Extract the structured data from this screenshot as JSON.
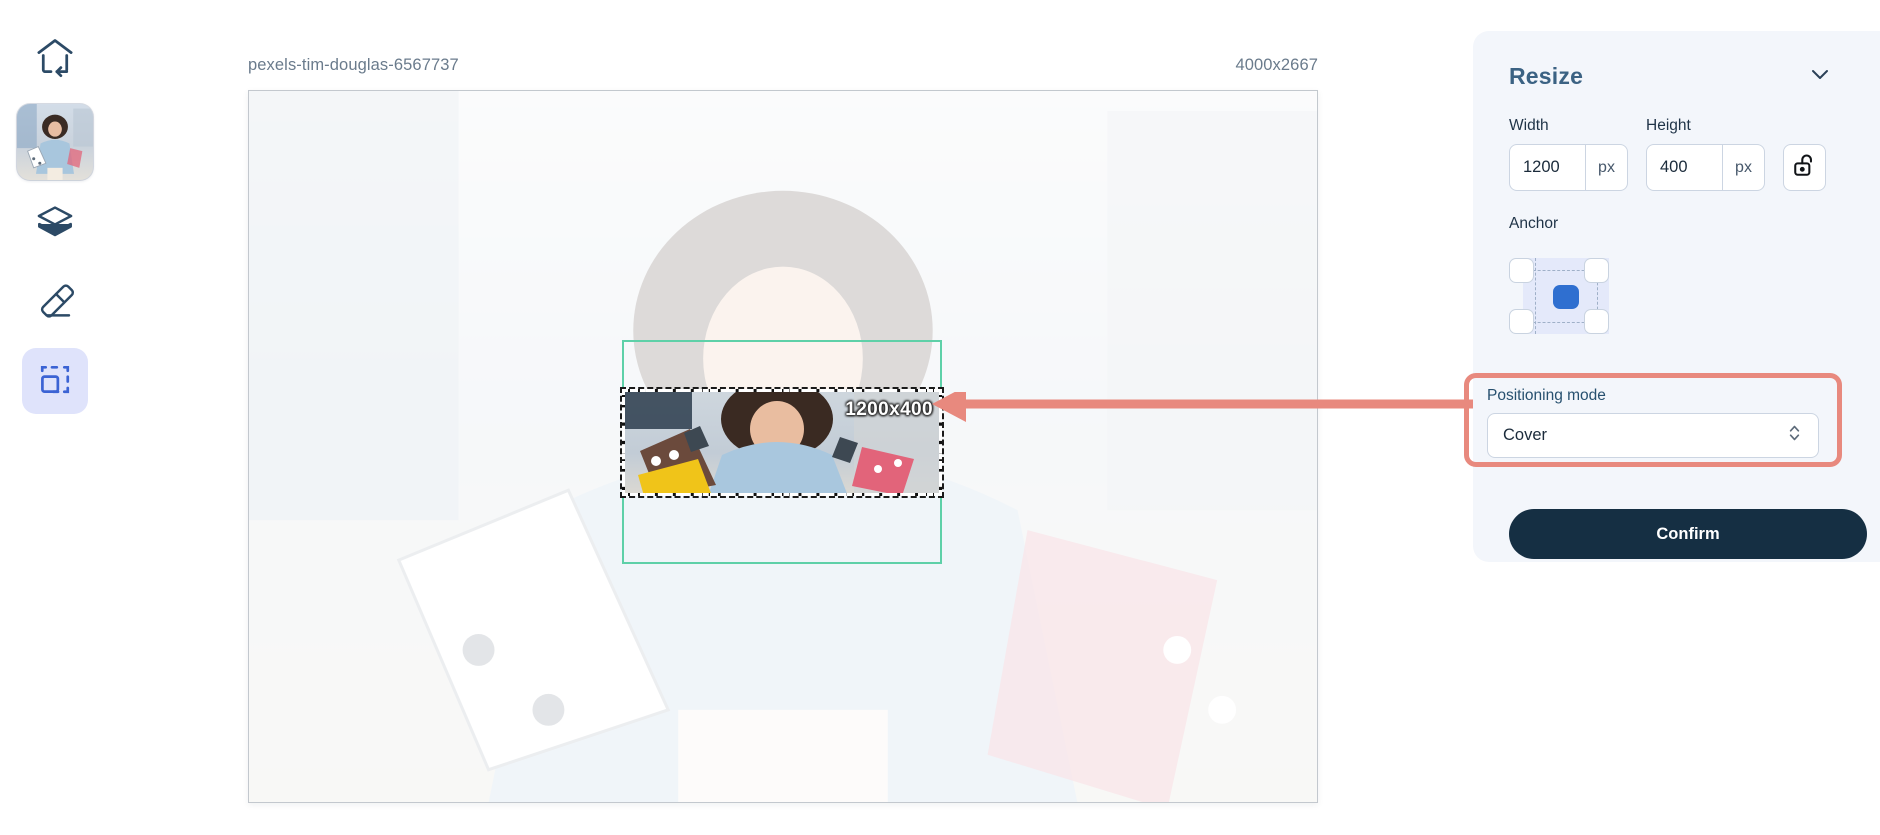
{
  "sidebar": {
    "items": [
      {
        "name": "home-back",
        "icon": "home-arrow-left-icon",
        "label": "Home"
      },
      {
        "name": "image-thumbnail",
        "icon": "image-thumbnail",
        "label": "Image"
      },
      {
        "name": "layers",
        "icon": "layers-icon",
        "label": "Layers"
      },
      {
        "name": "eraser",
        "icon": "eraser-icon",
        "label": "Eraser"
      },
      {
        "name": "resize",
        "icon": "resize-crop-icon",
        "label": "Resize",
        "active": true
      }
    ]
  },
  "canvas": {
    "filename": "pexels-tim-douglas-6567737",
    "dimensions": "4000x2667",
    "preview_dimensions": "1200x400",
    "selection_color": "#5ed0a8",
    "annotation_color": "#e8897e"
  },
  "panel": {
    "title": "Resize",
    "collapse_icon": "chevron-down-icon",
    "width": {
      "label": "Width",
      "value": "1200",
      "unit": "px"
    },
    "height": {
      "label": "Height",
      "value": "400",
      "unit": "px"
    },
    "lock_icon": "unlock-padlock-icon",
    "anchor": {
      "label": "Anchor",
      "selected": "center"
    },
    "positioning": {
      "label": "Positioning mode",
      "value": "Cover",
      "stepper_icon": "chevron-up-down-icon"
    },
    "confirm_label": "Confirm"
  }
}
